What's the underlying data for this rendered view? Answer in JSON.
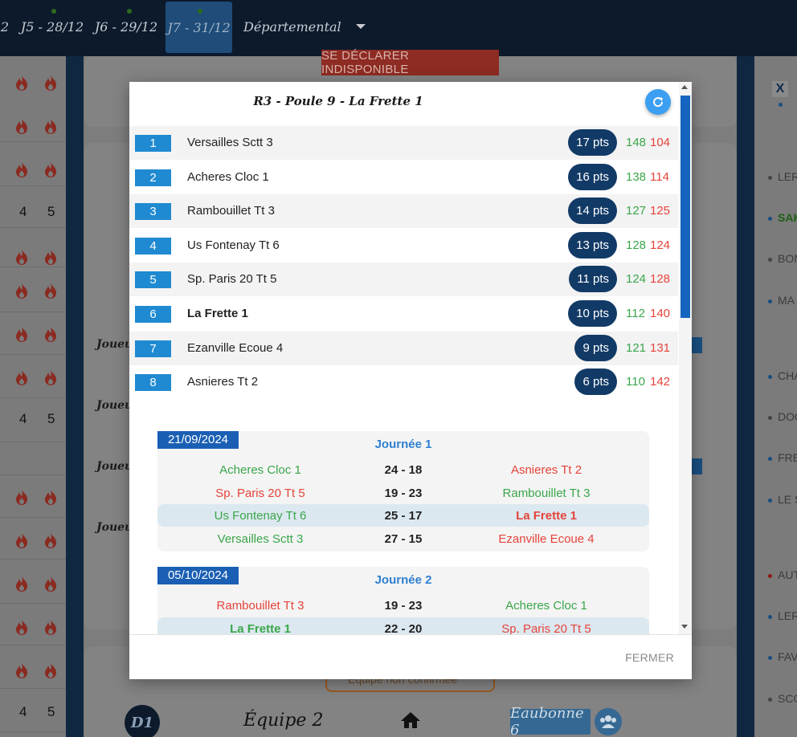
{
  "tabs": [
    {
      "label": "2",
      "dot": false
    },
    {
      "label": "J5 - 28/12",
      "dot": true
    },
    {
      "label": "J6 - 29/12",
      "dot": true
    },
    {
      "label": "J7 - 31/12",
      "dot": true,
      "active": true
    },
    {
      "label": "Départemental",
      "dot": false,
      "dropdown": true
    }
  ],
  "background": {
    "indisponible_label": "SE DÉCLARER INDISPONIBLE",
    "close_x": "X",
    "left_numbers": [
      "4",
      "5"
    ],
    "joueur_label": "Joueur",
    "right_labels": [
      "LER",
      "SAK",
      "BOM",
      "MA",
      "CHA",
      "DOO",
      "FRE",
      "LE S",
      "AUT",
      "LER",
      "FAV",
      "SCO"
    ],
    "unconfirmed_label": "Équipe non confirmée",
    "bottom": {
      "badge": "D1",
      "team": "Équipe 2",
      "opponent": "Eaubonne 6"
    }
  },
  "modal": {
    "title": "R3 - Poule 9 - La Frette 1",
    "close_label": "FERMER",
    "ranking": [
      {
        "pos": "1",
        "team": "Versailles Sctt 3",
        "pts": "17 pts",
        "gf": "148",
        "ga": "104"
      },
      {
        "pos": "2",
        "team": "Acheres Cloc 1",
        "pts": "16 pts",
        "gf": "138",
        "ga": "114"
      },
      {
        "pos": "3",
        "team": "Rambouillet Tt 3",
        "pts": "14 pts",
        "gf": "127",
        "ga": "125"
      },
      {
        "pos": "4",
        "team": "Us Fontenay Tt 6",
        "pts": "13 pts",
        "gf": "128",
        "ga": "124"
      },
      {
        "pos": "5",
        "team": "Sp. Paris 20 Tt 5",
        "pts": "11 pts",
        "gf": "124",
        "ga": "128"
      },
      {
        "pos": "6",
        "team": "La Frette 1",
        "pts": "10 pts",
        "gf": "112",
        "ga": "140",
        "bold": true
      },
      {
        "pos": "7",
        "team": "Ezanville Ecoue 4",
        "pts": "9 pts",
        "gf": "121",
        "ga": "131"
      },
      {
        "pos": "8",
        "team": "Asnieres Tt 2",
        "pts": "6 pts",
        "gf": "110",
        "ga": "142"
      }
    ],
    "journees": [
      {
        "date": "21/09/2024",
        "title": "Journée 1",
        "matches": [
          {
            "home": "Acheres Cloc 1",
            "score": "24 - 18",
            "away": "Asnieres Tt 2",
            "home_win": true,
            "highlight": false
          },
          {
            "home": "Sp. Paris 20 Tt 5",
            "score": "19 - 23",
            "away": "Rambouillet Tt 3",
            "home_win": false,
            "highlight": false
          },
          {
            "home": "Us Fontenay Tt 6",
            "score": "25 - 17",
            "away": "La Frette 1",
            "home_win": true,
            "highlight": true,
            "strong": "away"
          },
          {
            "home": "Versailles Sctt 3",
            "score": "27 - 15",
            "away": "Ezanville Ecoue 4",
            "home_win": true,
            "highlight": false
          }
        ]
      },
      {
        "date": "05/10/2024",
        "title": "Journée 2",
        "matches": [
          {
            "home": "Rambouillet Tt 3",
            "score": "19 - 23",
            "away": "Acheres Cloc 1",
            "home_win": false,
            "highlight": false
          },
          {
            "home": "La Frette 1",
            "score": "22 - 20",
            "away": "Sp. Paris 20 Tt 5",
            "home_win": true,
            "highlight": true,
            "strong": "home"
          }
        ]
      }
    ]
  },
  "colors": {
    "rank_badge": "#1f8ad1",
    "points_pill": "#123a66",
    "win": "#3aa64a",
    "loss": "#e5433a",
    "date_chip": "#1a5fb4",
    "refresh_button": "#3c9ff2"
  },
  "icons": {
    "refresh": "refresh-icon",
    "dropdown": "caret-down-icon",
    "home": "home-icon",
    "team": "group-icon",
    "flame": "flame-icon"
  }
}
